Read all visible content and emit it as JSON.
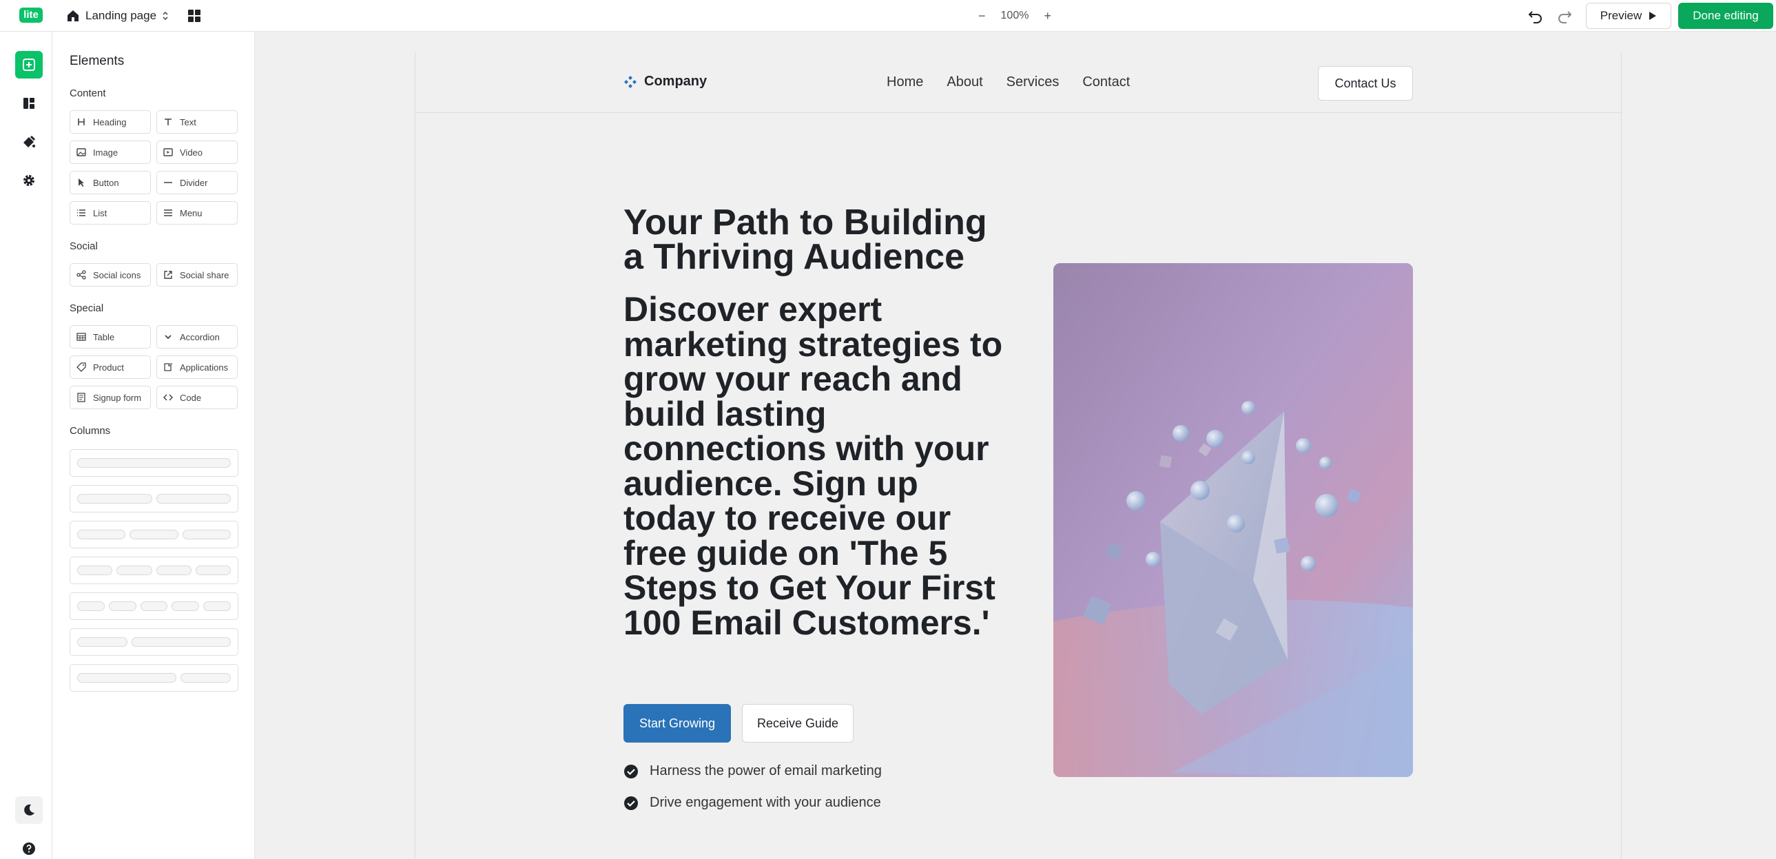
{
  "topbar": {
    "logo_text": "lite",
    "page_name": "Landing page",
    "zoom_minus": "−",
    "zoom_level": "100%",
    "zoom_plus": "+",
    "preview_label": "Preview",
    "done_label": "Done editing"
  },
  "panel": {
    "title": "Elements",
    "sections": {
      "content": "Content",
      "social": "Social",
      "special": "Special",
      "columns": "Columns"
    },
    "content_items": [
      "Heading",
      "Text",
      "Image",
      "Video",
      "Button",
      "Divider",
      "List",
      "Menu"
    ],
    "social_items": [
      "Social icons",
      "Social share"
    ],
    "special_items": [
      "Table",
      "Accordion",
      "Product",
      "Applications",
      "Signup form",
      "Code"
    ]
  },
  "site": {
    "brand": "Company",
    "nav": [
      "Home",
      "About",
      "Services",
      "Contact"
    ],
    "contact_button": "Contact Us",
    "hero_title": "Your Path to Building a Thriving Audience",
    "hero_subtitle": "Discover expert marketing strategies to grow your reach and build lasting connections with your audience. Sign up today to receive our free guide on 'The 5 Steps to Get Your First 100 Email Customers.'",
    "primary_button": "Start Growing",
    "secondary_button": "Receive Guide",
    "checklist": [
      "Harness the power of email marketing",
      "Drive engagement with your audience"
    ]
  },
  "colors": {
    "brand_green": "#09c269",
    "done_green": "#09a85a",
    "primary_blue": "#2b73b8",
    "canvas_bg": "#f0f0f0"
  },
  "icons": {
    "home": "home-icon",
    "grid": "grid-icon",
    "undo": "undo-icon",
    "redo": "redo-icon",
    "play": "play-icon",
    "add": "add-icon",
    "layout": "layout-icon",
    "style": "brush-icon",
    "settings": "gear-icon",
    "theme": "moon-icon",
    "help": "help-icon",
    "check": "check-circle-icon"
  }
}
